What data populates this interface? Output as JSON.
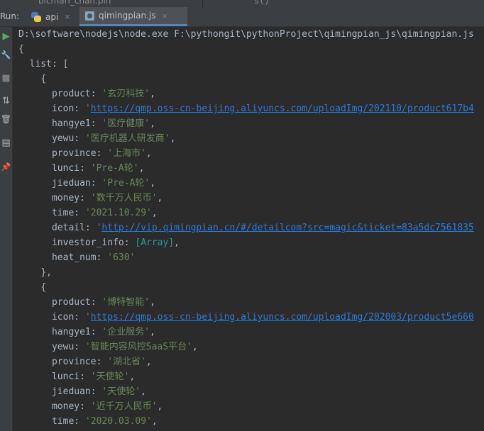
{
  "top_strip": {
    "stub_left": "bicmari_chan.pin",
    "stub_right": "s()"
  },
  "tabbar": {
    "run_label": "Run:",
    "tabs": [
      {
        "label": "api",
        "icon": "python-icon",
        "close": "×"
      },
      {
        "label": "qimingpian.js",
        "icon": "javascript-icon",
        "close": "×"
      }
    ]
  },
  "toolstrip": {
    "icons": [
      "run-icon",
      "wrench-icon",
      "stop-icon",
      "sort-lines-icon",
      "trash-icon",
      "layout-icon",
      "pin-icon"
    ],
    "glyphs": [
      "▶",
      "🔧",
      "■",
      "⇅",
      "🗑",
      "▤",
      "📌"
    ]
  },
  "console": {
    "lines": [
      {
        "indent": "",
        "text": "D:\\software\\nodejs\\node.exe F:\\pythongit\\pythonProject\\qimingpian_js\\qimingpian.js"
      },
      {
        "indent": "",
        "text": "{"
      },
      {
        "indent": "  ",
        "text": "list: ["
      },
      {
        "indent": "    ",
        "text": "{"
      },
      {
        "indent": "      ",
        "key": "product: ",
        "str": "'玄刃科技'",
        "tail": ","
      },
      {
        "indent": "      ",
        "key": "icon: ",
        "link_prefix": "'",
        "link": "https://qmp.oss-cn-beijing.aliyuncs.com/uploadImg/202110/product617b4"
      },
      {
        "indent": "      ",
        "key": "hangye1: ",
        "str": "'医疗健康'",
        "tail": ","
      },
      {
        "indent": "      ",
        "key": "yewu: ",
        "str": "'医疗机器人研发商'",
        "tail": ","
      },
      {
        "indent": "      ",
        "key": "province: ",
        "str": "'上海市'",
        "tail": ","
      },
      {
        "indent": "      ",
        "key": "lunci: ",
        "str": "'Pre-A轮'",
        "tail": ","
      },
      {
        "indent": "      ",
        "key": "jieduan: ",
        "str": "'Pre-A轮'",
        "tail": ","
      },
      {
        "indent": "      ",
        "key": "money: ",
        "str": "'数千万人民币'",
        "tail": ","
      },
      {
        "indent": "      ",
        "key": "time: ",
        "str": "'2021.10.29'",
        "tail": ","
      },
      {
        "indent": "      ",
        "key": "detail: ",
        "link_prefix": "'",
        "link": "http://vip.qimingpian.cn/#/detailcom?src=magic&ticket=83a5dc7561835"
      },
      {
        "indent": "      ",
        "key": "investor_info: ",
        "arr": "[Array]",
        "tail": ","
      },
      {
        "indent": "      ",
        "key": "heat_num: ",
        "str": "'630'",
        "tail": ""
      },
      {
        "indent": "    ",
        "text": "},"
      },
      {
        "indent": "    ",
        "text": "{"
      },
      {
        "indent": "      ",
        "key": "product: ",
        "str": "'博特智能'",
        "tail": ","
      },
      {
        "indent": "      ",
        "key": "icon: ",
        "link_prefix": "'",
        "link": "https://qmp.oss-cn-beijing.aliyuncs.com/uploadImg/202003/product5e660"
      },
      {
        "indent": "      ",
        "key": "hangye1: ",
        "str": "'企业服务'",
        "tail": ","
      },
      {
        "indent": "      ",
        "key": "yewu: ",
        "str": "'智能内容风控SaaS平台'",
        "tail": ","
      },
      {
        "indent": "      ",
        "key": "province: ",
        "str": "'湖北省'",
        "tail": ","
      },
      {
        "indent": "      ",
        "key": "lunci: ",
        "str": "'天使轮'",
        "tail": ","
      },
      {
        "indent": "      ",
        "key": "jieduan: ",
        "str": "'天使轮'",
        "tail": ","
      },
      {
        "indent": "      ",
        "key": "money: ",
        "str": "'近千万人民币'",
        "tail": ","
      },
      {
        "indent": "      ",
        "key": "time: ",
        "str": "'2020.03.09'",
        "tail": ","
      }
    ]
  }
}
